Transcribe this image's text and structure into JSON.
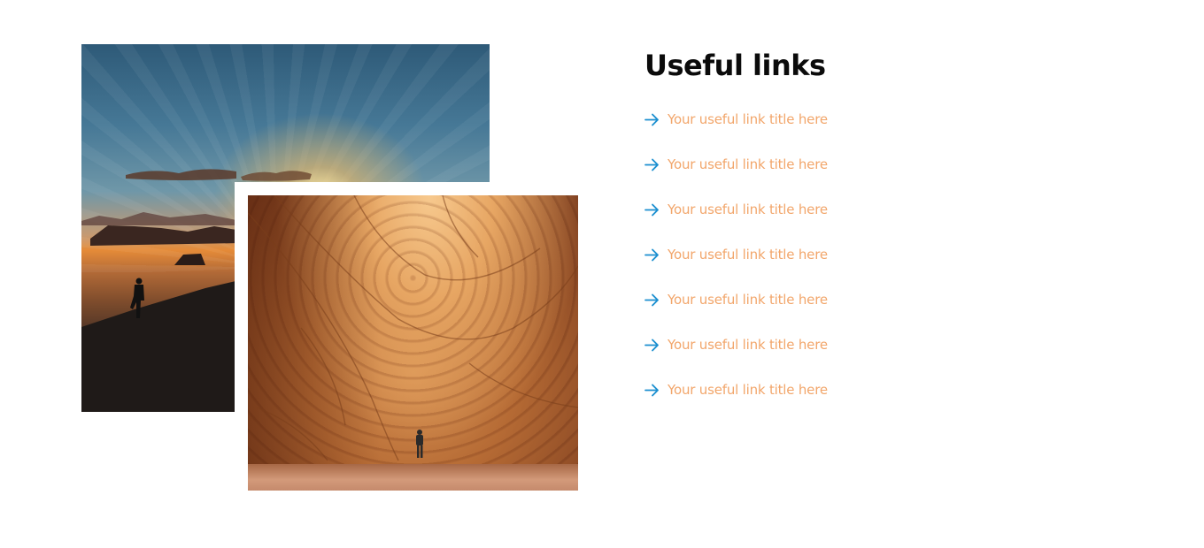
{
  "colors": {
    "link_text": "#f2a66b",
    "link_arrow": "#1b8fd0",
    "heading": "#0b0b0b",
    "background": "#ffffff"
  },
  "collage": {
    "image_1_subject": "desert-sunset-hiker",
    "image_2_subject": "canyon-rock-wall-hiker"
  },
  "useful_links": {
    "title": "Useful links",
    "icon": "arrow-right-icon",
    "items": [
      {
        "label": "Your useful link title here"
      },
      {
        "label": "Your useful link title here"
      },
      {
        "label": "Your useful link title here"
      },
      {
        "label": "Your useful link title here"
      },
      {
        "label": "Your useful link title here"
      },
      {
        "label": "Your useful link title here"
      },
      {
        "label": "Your useful link title here"
      }
    ]
  }
}
